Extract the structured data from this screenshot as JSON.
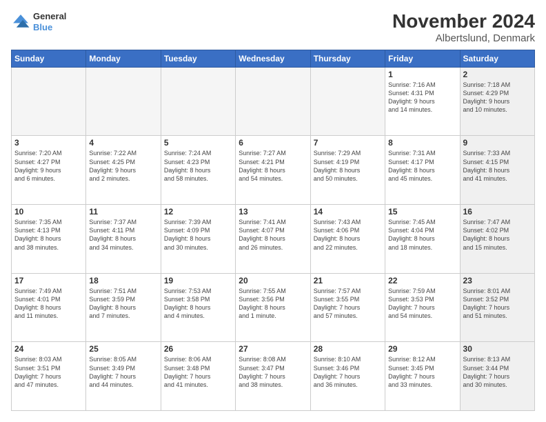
{
  "logo": {
    "line1": "General",
    "line2": "Blue"
  },
  "title": "November 2024",
  "subtitle": "Albertslund, Denmark",
  "days_header": [
    "Sunday",
    "Monday",
    "Tuesday",
    "Wednesday",
    "Thursday",
    "Friday",
    "Saturday"
  ],
  "weeks": [
    [
      {
        "day": "",
        "info": "",
        "empty": true
      },
      {
        "day": "",
        "info": "",
        "empty": true
      },
      {
        "day": "",
        "info": "",
        "empty": true
      },
      {
        "day": "",
        "info": "",
        "empty": true
      },
      {
        "day": "",
        "info": "",
        "empty": true
      },
      {
        "day": "1",
        "info": "Sunrise: 7:16 AM\nSunset: 4:31 PM\nDaylight: 9 hours\nand 14 minutes.",
        "empty": false
      },
      {
        "day": "2",
        "info": "Sunrise: 7:18 AM\nSunset: 4:29 PM\nDaylight: 9 hours\nand 10 minutes.",
        "empty": false,
        "shaded": true
      }
    ],
    [
      {
        "day": "3",
        "info": "Sunrise: 7:20 AM\nSunset: 4:27 PM\nDaylight: 9 hours\nand 6 minutes.",
        "empty": false
      },
      {
        "day": "4",
        "info": "Sunrise: 7:22 AM\nSunset: 4:25 PM\nDaylight: 9 hours\nand 2 minutes.",
        "empty": false
      },
      {
        "day": "5",
        "info": "Sunrise: 7:24 AM\nSunset: 4:23 PM\nDaylight: 8 hours\nand 58 minutes.",
        "empty": false
      },
      {
        "day": "6",
        "info": "Sunrise: 7:27 AM\nSunset: 4:21 PM\nDaylight: 8 hours\nand 54 minutes.",
        "empty": false
      },
      {
        "day": "7",
        "info": "Sunrise: 7:29 AM\nSunset: 4:19 PM\nDaylight: 8 hours\nand 50 minutes.",
        "empty": false
      },
      {
        "day": "8",
        "info": "Sunrise: 7:31 AM\nSunset: 4:17 PM\nDaylight: 8 hours\nand 45 minutes.",
        "empty": false
      },
      {
        "day": "9",
        "info": "Sunrise: 7:33 AM\nSunset: 4:15 PM\nDaylight: 8 hours\nand 41 minutes.",
        "empty": false,
        "shaded": true
      }
    ],
    [
      {
        "day": "10",
        "info": "Sunrise: 7:35 AM\nSunset: 4:13 PM\nDaylight: 8 hours\nand 38 minutes.",
        "empty": false
      },
      {
        "day": "11",
        "info": "Sunrise: 7:37 AM\nSunset: 4:11 PM\nDaylight: 8 hours\nand 34 minutes.",
        "empty": false
      },
      {
        "day": "12",
        "info": "Sunrise: 7:39 AM\nSunset: 4:09 PM\nDaylight: 8 hours\nand 30 minutes.",
        "empty": false
      },
      {
        "day": "13",
        "info": "Sunrise: 7:41 AM\nSunset: 4:07 PM\nDaylight: 8 hours\nand 26 minutes.",
        "empty": false
      },
      {
        "day": "14",
        "info": "Sunrise: 7:43 AM\nSunset: 4:06 PM\nDaylight: 8 hours\nand 22 minutes.",
        "empty": false
      },
      {
        "day": "15",
        "info": "Sunrise: 7:45 AM\nSunset: 4:04 PM\nDaylight: 8 hours\nand 18 minutes.",
        "empty": false
      },
      {
        "day": "16",
        "info": "Sunrise: 7:47 AM\nSunset: 4:02 PM\nDaylight: 8 hours\nand 15 minutes.",
        "empty": false,
        "shaded": true
      }
    ],
    [
      {
        "day": "17",
        "info": "Sunrise: 7:49 AM\nSunset: 4:01 PM\nDaylight: 8 hours\nand 11 minutes.",
        "empty": false
      },
      {
        "day": "18",
        "info": "Sunrise: 7:51 AM\nSunset: 3:59 PM\nDaylight: 8 hours\nand 7 minutes.",
        "empty": false
      },
      {
        "day": "19",
        "info": "Sunrise: 7:53 AM\nSunset: 3:58 PM\nDaylight: 8 hours\nand 4 minutes.",
        "empty": false
      },
      {
        "day": "20",
        "info": "Sunrise: 7:55 AM\nSunset: 3:56 PM\nDaylight: 8 hours\nand 1 minute.",
        "empty": false
      },
      {
        "day": "21",
        "info": "Sunrise: 7:57 AM\nSunset: 3:55 PM\nDaylight: 7 hours\nand 57 minutes.",
        "empty": false
      },
      {
        "day": "22",
        "info": "Sunrise: 7:59 AM\nSunset: 3:53 PM\nDaylight: 7 hours\nand 54 minutes.",
        "empty": false
      },
      {
        "day": "23",
        "info": "Sunrise: 8:01 AM\nSunset: 3:52 PM\nDaylight: 7 hours\nand 51 minutes.",
        "empty": false,
        "shaded": true
      }
    ],
    [
      {
        "day": "24",
        "info": "Sunrise: 8:03 AM\nSunset: 3:51 PM\nDaylight: 7 hours\nand 47 minutes.",
        "empty": false
      },
      {
        "day": "25",
        "info": "Sunrise: 8:05 AM\nSunset: 3:49 PM\nDaylight: 7 hours\nand 44 minutes.",
        "empty": false
      },
      {
        "day": "26",
        "info": "Sunrise: 8:06 AM\nSunset: 3:48 PM\nDaylight: 7 hours\nand 41 minutes.",
        "empty": false
      },
      {
        "day": "27",
        "info": "Sunrise: 8:08 AM\nSunset: 3:47 PM\nDaylight: 7 hours\nand 38 minutes.",
        "empty": false
      },
      {
        "day": "28",
        "info": "Sunrise: 8:10 AM\nSunset: 3:46 PM\nDaylight: 7 hours\nand 36 minutes.",
        "empty": false
      },
      {
        "day": "29",
        "info": "Sunrise: 8:12 AM\nSunset: 3:45 PM\nDaylight: 7 hours\nand 33 minutes.",
        "empty": false
      },
      {
        "day": "30",
        "info": "Sunrise: 8:13 AM\nSunset: 3:44 PM\nDaylight: 7 hours\nand 30 minutes.",
        "empty": false,
        "shaded": true
      }
    ]
  ]
}
